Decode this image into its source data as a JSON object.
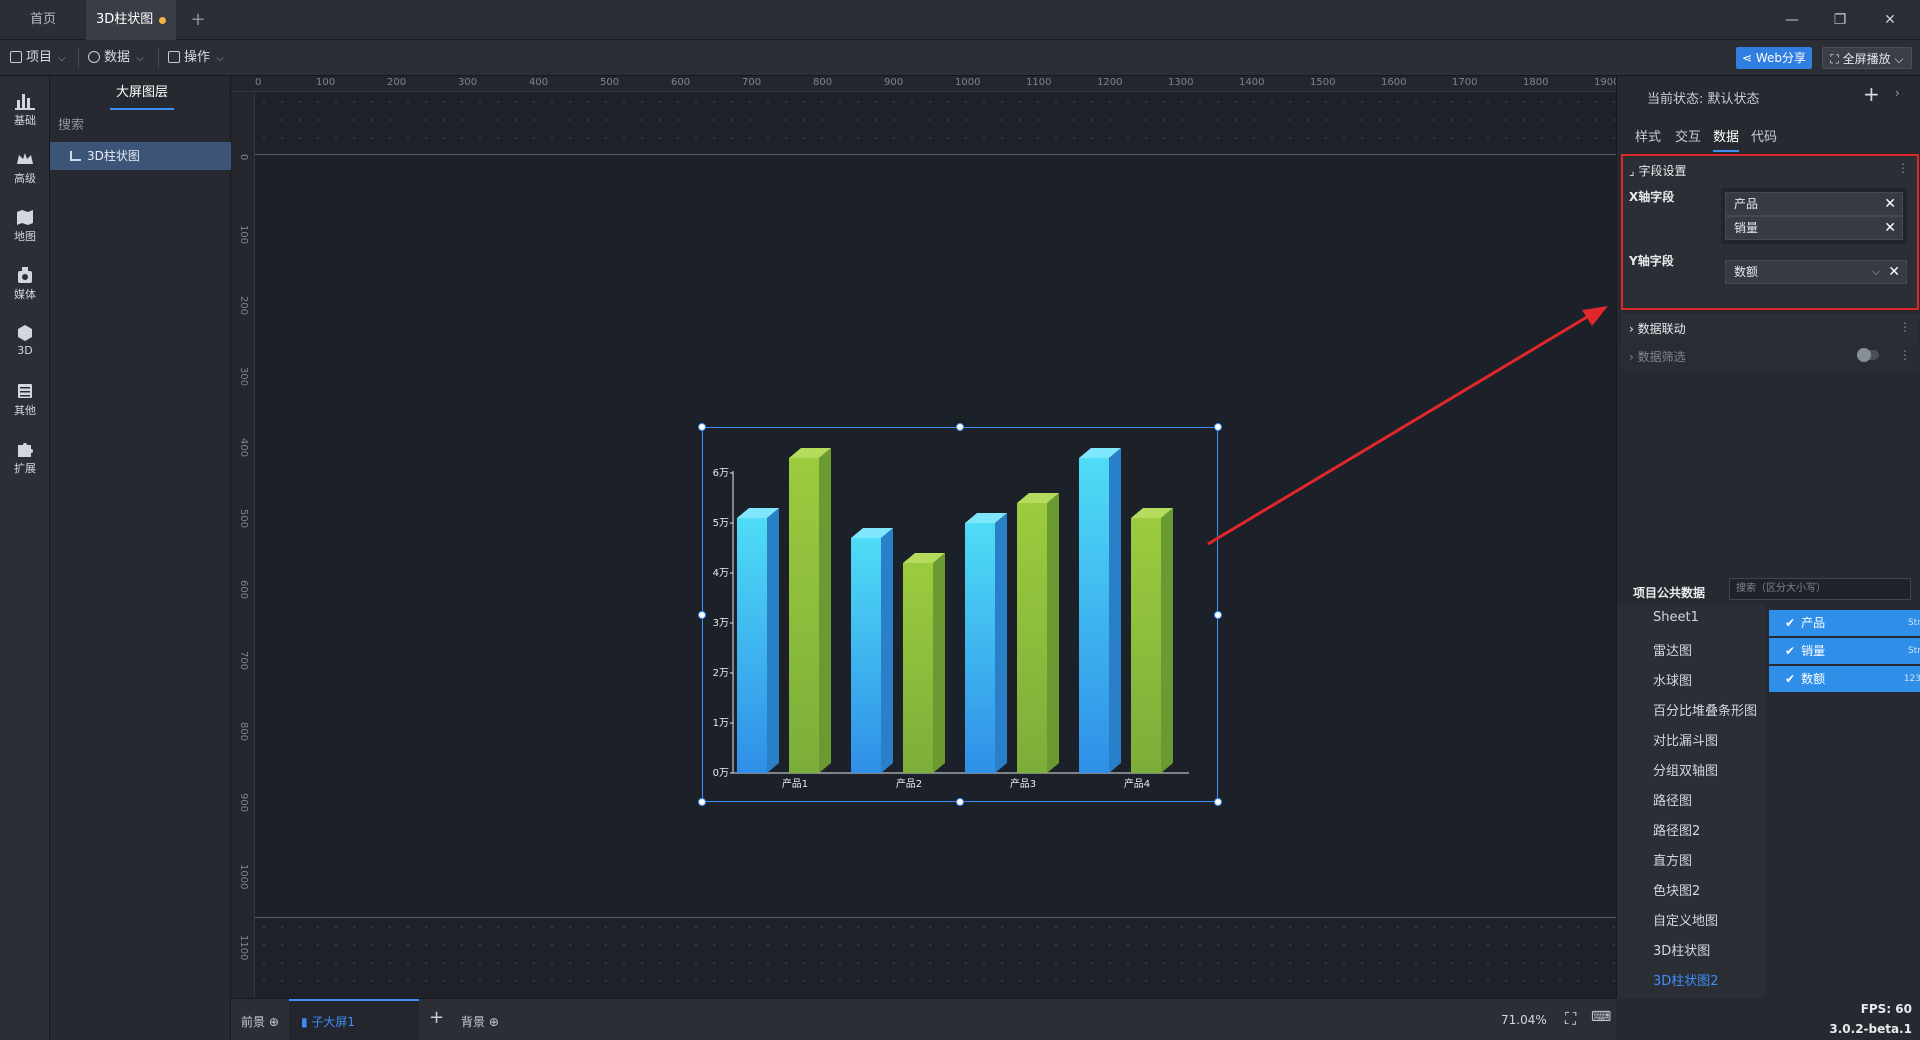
{
  "tabs": {
    "home": "首页",
    "active": "3D柱状图",
    "add": "+"
  },
  "window": {
    "minimize": "—",
    "restore": "❐",
    "close": "✕"
  },
  "menubar": {
    "project": "项目",
    "data": "数据",
    "operate": "操作",
    "share": "Web分享",
    "fullscreen": "全屏播放"
  },
  "categories": [
    "基础",
    "高级",
    "地图",
    "媒体",
    "3D",
    "其他",
    "扩展"
  ],
  "layers": {
    "title": "大屏图层",
    "search": "搜索",
    "item": "3D柱状图"
  },
  "rulers": {
    "top": [
      "0",
      "100",
      "200",
      "300",
      "400",
      "500",
      "600",
      "700",
      "800",
      "900",
      "1000",
      "1100",
      "1200",
      "1300",
      "1400",
      "1500",
      "1600",
      "1700",
      "1800",
      "1900"
    ],
    "left": [
      "0",
      "100",
      "200",
      "300",
      "400",
      "500",
      "600",
      "700",
      "800",
      "900",
      "1000",
      "1100"
    ]
  },
  "chart_data": {
    "type": "bar",
    "categories": [
      "产品1",
      "产品2",
      "产品3",
      "产品4"
    ],
    "series": [
      {
        "values": [
          51000,
          63000
        ],
        "color": "#38b8f2"
      },
      {
        "values": [
          47000,
          42000
        ],
        "color": "#8cc63f"
      }
    ],
    "pairs": [
      [
        51000,
        63000
      ],
      [
        47000,
        42000
      ],
      [
        50000,
        54000
      ],
      [
        63000,
        51000
      ]
    ],
    "colors": [
      "#38b8f2",
      "#8cc63f"
    ],
    "yticks": [
      "0万",
      "1万",
      "2万",
      "3万",
      "4万",
      "5万",
      "6万"
    ],
    "ylim": [
      0,
      60000
    ],
    "ylabel": "",
    "xlabel": "",
    "title": ""
  },
  "right": {
    "status": "当前状态:  默认状态",
    "plus": "+",
    "more": "›",
    "tabs": [
      "样式",
      "交互",
      "数据",
      "代码"
    ],
    "field_section": "字段设置",
    "x_label": "X轴字段",
    "x_fields": [
      "产品",
      "销量"
    ],
    "y_label": "Y轴字段",
    "y_field": "数额",
    "linkage": "数据联动",
    "filter": "数据筛选",
    "public_title": "项目公共数据",
    "public_search": "搜索（区分大小写）",
    "sheets": [
      "Sheet1",
      "雷达图",
      "水球图",
      "百分比堆叠条形图",
      "对比漏斗图",
      "分组双轴图",
      "路径图",
      "路径图2",
      "直方图",
      "色块图2",
      "自定义地图",
      "3D柱状图",
      "3D柱状图2"
    ],
    "fields": [
      {
        "name": "产品",
        "type": "Str"
      },
      {
        "name": "销量",
        "type": "Str"
      },
      {
        "name": "数额",
        "type": "123"
      }
    ]
  },
  "bottom": {
    "foreground": "前景",
    "subscreen": "子大屏1",
    "add": "+",
    "background": "背景",
    "zoom": "71.04%"
  },
  "footer": {
    "fps": "FPS: 60",
    "version": "3.0.2-beta.1"
  }
}
